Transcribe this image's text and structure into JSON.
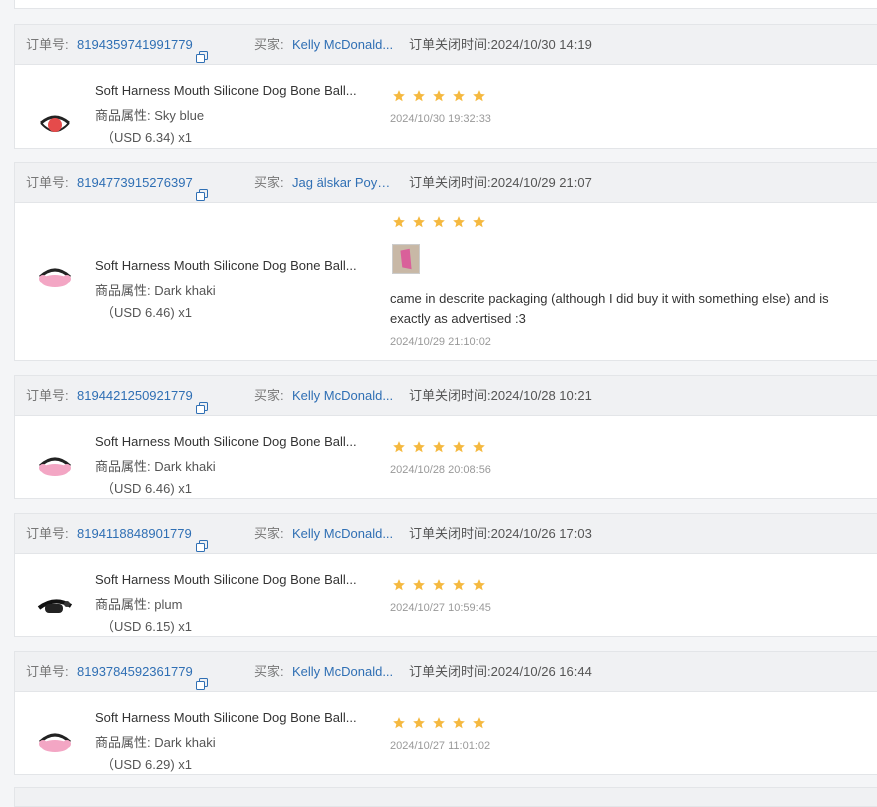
{
  "labels": {
    "order_no": "订单号:",
    "buyer": "买家:",
    "attr_prefix": "商品属性:",
    "price_prefix": "（USD"
  },
  "colors": {
    "link": "#2f6fb4",
    "star": "#f5b940",
    "header_bg": "#f0f1f3"
  },
  "orders": [
    {
      "order_no": "8194359741991779",
      "buyer": "Kelly McDonald...",
      "close_time": "订单关闭时间:2024/10/30 14:19",
      "product": "Soft Harness Mouth Silicone Dog Bone Ball...",
      "attr": "商品属性:  Sky blue",
      "price": "（USD  6.34)  x1",
      "rating": 5,
      "review_text": "",
      "review_time": "2024/10/30 19:32:33",
      "thumb_color": "#e54b4b"
    },
    {
      "order_no": "8194773915276397",
      "buyer": "Jag älskar Poyor...",
      "close_time": "订单关闭时间:2024/10/29 21:07",
      "product": "Soft Harness Mouth Silicone Dog Bone Ball...",
      "attr": "商品属性:  Dark khaki",
      "price": "（USD  6.46)  x1",
      "rating": 5,
      "review_text": "came in descrite packaging (although I did buy it with something else) and is exactly as advertised :3",
      "review_time": "2024/10/29 21:10:02",
      "thumb_color": "#f3a6c4"
    },
    {
      "order_no": "8194421250921779",
      "buyer": "Kelly McDonald...",
      "close_time": "订单关闭时间:2024/10/28 10:21",
      "product": "Soft Harness Mouth Silicone Dog Bone Ball...",
      "attr": "商品属性:  Dark khaki",
      "price": "（USD  6.46)  x1",
      "rating": 5,
      "review_text": "",
      "review_time": "2024/10/28 20:08:56",
      "thumb_color": "#f3a6c4"
    },
    {
      "order_no": "8194118848901779",
      "buyer": "Kelly McDonald...",
      "close_time": "订单关闭时间:2024/10/26 17:03",
      "product": "Soft Harness Mouth Silicone Dog Bone Ball...",
      "attr": "商品属性:  plum",
      "price": "（USD  6.15)  x1",
      "rating": 5,
      "review_text": "",
      "review_time": "2024/10/27 10:59:45",
      "thumb_color": "#222222"
    },
    {
      "order_no": "8193784592361779",
      "buyer": "Kelly McDonald...",
      "close_time": "订单关闭时间:2024/10/26 16:44",
      "product": "Soft Harness Mouth Silicone Dog Bone Ball...",
      "attr": "商品属性:  Dark khaki",
      "price": "（USD  6.29)  x1",
      "rating": 5,
      "review_text": "",
      "review_time": "2024/10/27 11:01:02",
      "thumb_color": "#f3a6c4"
    }
  ]
}
